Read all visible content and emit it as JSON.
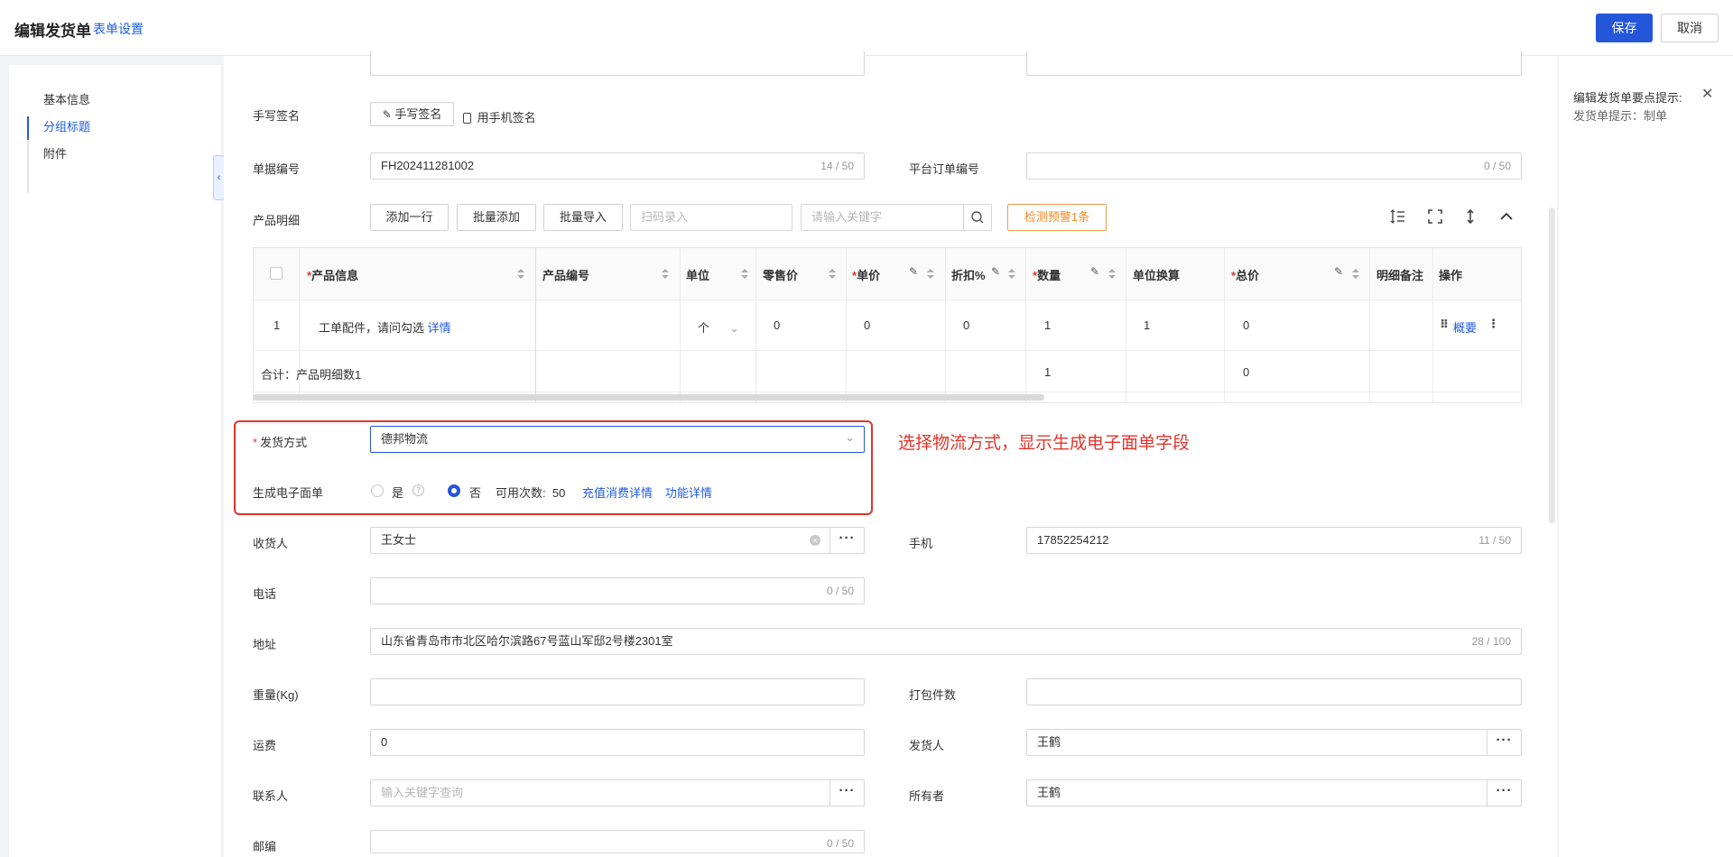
{
  "header": {
    "title": "编辑发货单",
    "settings_link": "表单设置",
    "save": "保存",
    "cancel": "取消"
  },
  "nav": {
    "items": [
      "基本信息",
      "分组标题",
      "附件"
    ],
    "active": 1
  },
  "right_panel": {
    "title": "编辑发货单要点提示:",
    "tip": "发货单提示：制单"
  },
  "form": {
    "signature": {
      "label": "手写签名",
      "btn_handwrite": "手写签名",
      "btn_phone": "用手机签名"
    },
    "doc_no": {
      "label": "单据编号",
      "value": "FH202411281002",
      "count": "14 / 50"
    },
    "platform_no": {
      "label": "平台订单编号",
      "count": "0 / 50"
    },
    "products": {
      "label": "产品明细",
      "btn_add_row": "添加一行",
      "btn_batch_add": "批量添加",
      "btn_batch_import": "批量导入",
      "scan_placeholder": "扫码录入",
      "keyword_placeholder": "请输入关键字",
      "warn_btn": "检测预警1条"
    },
    "shipping_method": {
      "label": "发货方式",
      "value": "德邦物流"
    },
    "e_waybill": {
      "label": "生成电子面单",
      "opt_yes": "是",
      "opt_no": "否",
      "selected": "否",
      "available": "可用次数:  50",
      "recharge_link": "充值消费详情",
      "feature_link": "功能详情"
    },
    "receiver": {
      "label": "收货人",
      "value": "王女士"
    },
    "mobile": {
      "label": "手机",
      "value": "17852254212",
      "count": "11 / 50"
    },
    "phone": {
      "label": "电话",
      "count": "0 / 50"
    },
    "address": {
      "label": "地址",
      "value": "山东省青岛市市北区哈尔滨路67号蓝山军邸2号楼2301室",
      "count": "28 / 100"
    },
    "weight": {
      "label": "重量(Kg)"
    },
    "package_count": {
      "label": "打包件数"
    },
    "freight": {
      "label": "运费",
      "value": "0"
    },
    "shipper": {
      "label": "发货人",
      "value": "王鹤"
    },
    "contact": {
      "label": "联系人",
      "placeholder": "输入关键字查询"
    },
    "owner": {
      "label": "所有者",
      "value": "王鹤"
    },
    "zipcode": {
      "label": "邮编",
      "count": "0 / 50"
    }
  },
  "table": {
    "headers": {
      "product_info": "产品信息",
      "product_code": "产品编号",
      "unit": "单位",
      "retail_price": "零售价",
      "unit_price": "单价",
      "discount": "折扣%",
      "quantity": "数量",
      "unit_conversion": "单位换算",
      "total": "总价",
      "remark": "明细备注",
      "actions": "操作"
    },
    "row": {
      "index": "1",
      "product_info": "工单配件，请问勾选",
      "detail_link": "详情",
      "unit": "个",
      "retail_price": "0",
      "unit_price": "0",
      "discount": "0",
      "quantity": "1",
      "unit_conversion": "1",
      "total": "0",
      "summary_link": "概要"
    },
    "summary": {
      "label": "合计：产品明细数1",
      "quantity": "1",
      "total": "0"
    }
  },
  "annotation": "选择物流方式，显示生成电子面单字段",
  "colors": {
    "primary": "#2456d9",
    "link": "#1f5ce0",
    "highlight": "#e0352b",
    "warning": "#f08a24"
  }
}
